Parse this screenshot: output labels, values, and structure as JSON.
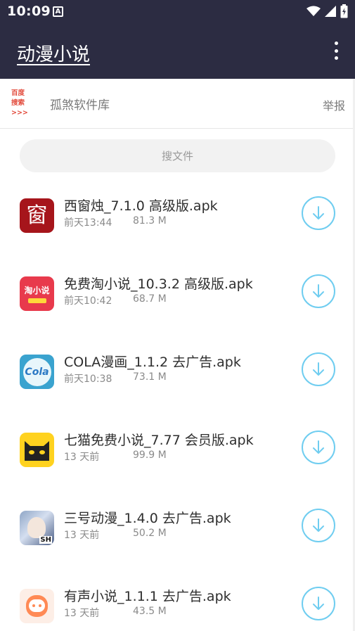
{
  "status_bar": {
    "time": "10:09",
    "notification_glyph": "A"
  },
  "app_bar": {
    "title": "动漫小说"
  },
  "ad_bar": {
    "logo_line1": "百度",
    "logo_line2": "搜索>>>",
    "site_name": "孤煞软件库",
    "report_label": "举报"
  },
  "search": {
    "label": "搜文件"
  },
  "files": [
    {
      "name": "西窗烛_7.1.0 高级版.apk",
      "time": "前天13:44",
      "size": "81.3 M",
      "icon": "xichuangzhu-icon",
      "icon_text": "窗"
    },
    {
      "name": "免费淘小说_10.3.2 高级版.apk",
      "time": "前天10:42",
      "size": "68.7 M",
      "icon": "mianfei-taoxiaoshuo-icon",
      "icon_text": "淘小说"
    },
    {
      "name": "COLA漫画_1.1.2 去广告.apk",
      "time": "前天10:38",
      "size": "73.1 M",
      "icon": "cola-manhua-icon",
      "icon_text": "Cola"
    },
    {
      "name": "七猫免费小说_7.77 会员版.apk",
      "time": "13 天前",
      "size": "99.9 M",
      "icon": "qimao-cat-icon",
      "icon_text": ""
    },
    {
      "name": "三号动漫_1.4.0 去广告.apk",
      "time": "13 天前",
      "size": "50.2 M",
      "icon": "sanhao-dongman-icon",
      "icon_text": "SH"
    },
    {
      "name": "有声小说_1.1.1 去广告.apk",
      "time": "13 天前",
      "size": "43.5 M",
      "icon": "yousheng-xiaoshuo-icon",
      "icon_text": ""
    }
  ],
  "colors": {
    "header_bg": "#2c2c42",
    "accent": "#6fcdf0",
    "text_primary": "#2e2e2e",
    "text_secondary": "#8a8a8a"
  }
}
